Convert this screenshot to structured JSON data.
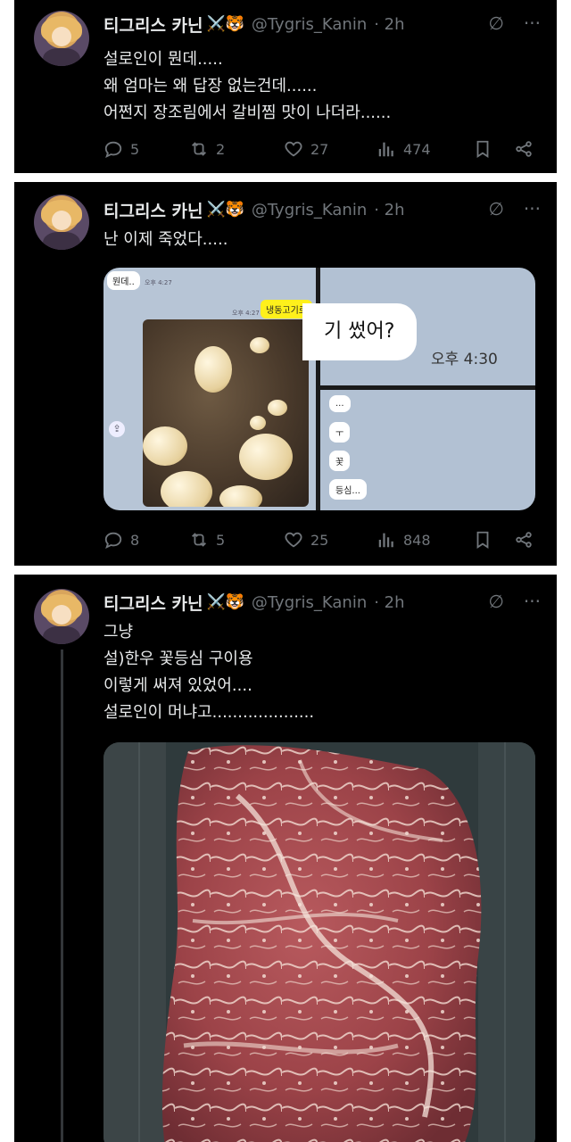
{
  "user": {
    "name": "티그리스 카닌",
    "badge_emoji": "⚔️🐯",
    "handle": "@Tygris_Kanin",
    "time": "· 2h"
  },
  "tweets": [
    {
      "lines": [
        "설로인이 뭔데.....",
        "왜 엄마는 왜 답장 없는건데......",
        "어쩐지 장조림에서 갈비찜 맛이 나더라......"
      ],
      "replies": "5",
      "retweets": "2",
      "likes": "27",
      "views": "474"
    },
    {
      "lines": [
        "난 이제 죽었다....."
      ],
      "replies": "8",
      "retweets": "5",
      "likes": "25",
      "views": "848",
      "media": {
        "chat_top": "뭔데..",
        "chat_time1": "오후 4:27",
        "chat_yellow": "냉동고기로",
        "chat_time2": "오후 4:27",
        "big_bubble": "기 썼어?",
        "big_time": "오후 4:30",
        "small_bubbles": [
          "...",
          "ㅜ",
          "꽃",
          "등심..."
        ]
      }
    },
    {
      "lines": [
        "그냥",
        "설)한우 꽃등심 구이용",
        "이렇게 써져 있었어....",
        "설로인이 머냐고...................."
      ]
    }
  ],
  "icons": {
    "grok": "grok-icon",
    "more": "more-icon",
    "reply": "reply-icon",
    "retweet": "retweet-icon",
    "like": "heart-icon",
    "views": "views-icon",
    "bookmark": "bookmark-icon",
    "share": "share-icon"
  },
  "colors": {
    "background": "#000000",
    "text": "#e7e9ea",
    "muted": "#71767b"
  }
}
